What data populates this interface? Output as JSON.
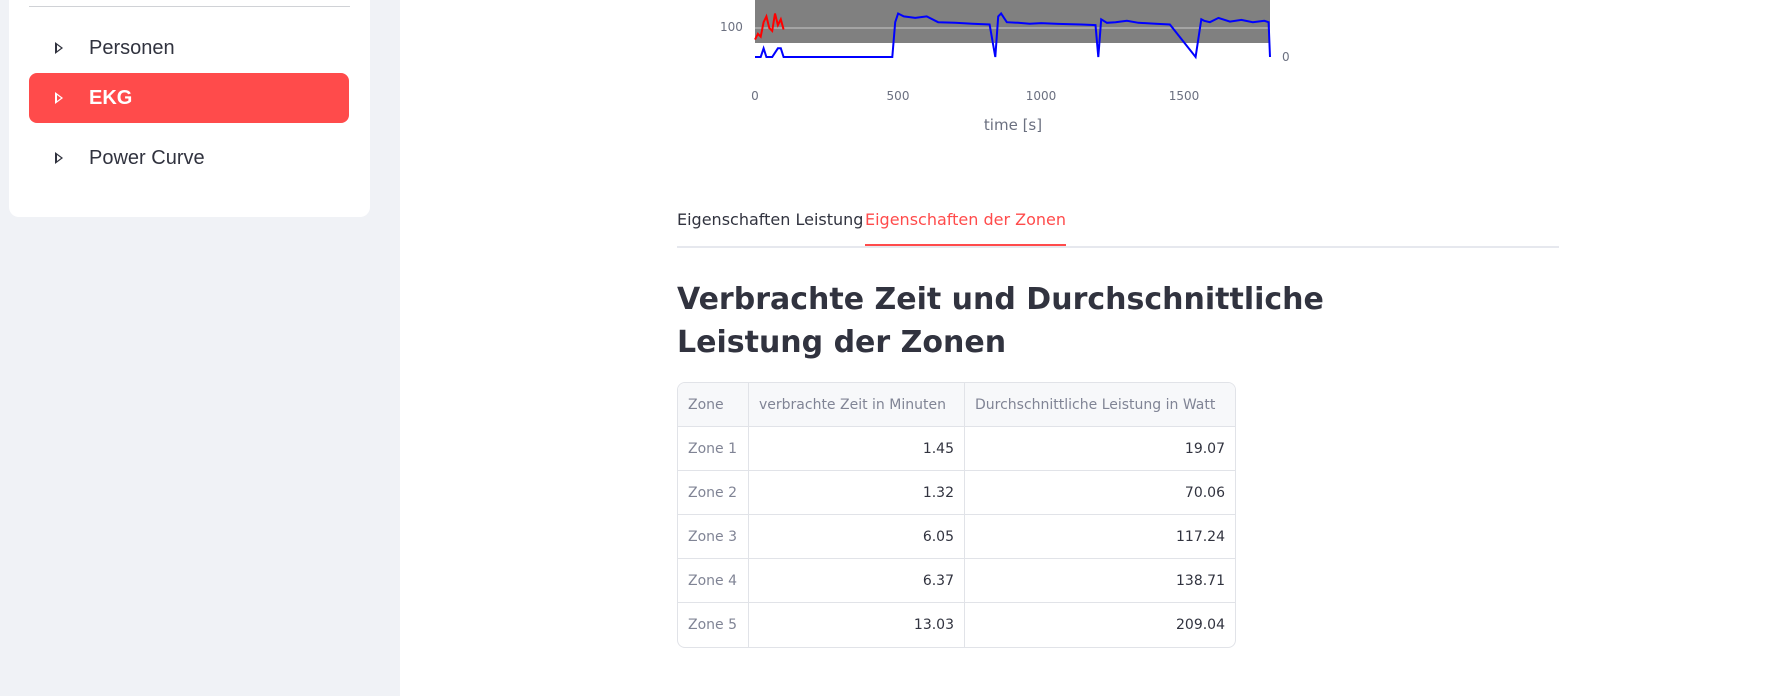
{
  "sidebar": {
    "items": [
      {
        "label": "Personen",
        "active": false
      },
      {
        "label": "EKG",
        "active": true
      },
      {
        "label": "Power Curve",
        "active": false
      }
    ]
  },
  "chart_data": {
    "type": "line",
    "xlabel": "time [s]",
    "x_ticks": [
      "0",
      "500",
      "1000",
      "1500"
    ],
    "y_ticks_left": [
      "100"
    ],
    "y_ticks_right": [
      "0"
    ],
    "xlim": [
      0,
      1800
    ],
    "series": [
      {
        "color": "#0000ff",
        "x": [
          0,
          20,
          30,
          40,
          60,
          80,
          90,
          100,
          480,
          490,
          500,
          520,
          560,
          600,
          640,
          700,
          760,
          820,
          840,
          850,
          860,
          880,
          920,
          960,
          1000,
          1060,
          1140,
          1190,
          1200,
          1210,
          1230,
          1260,
          1300,
          1340,
          1400,
          1450,
          1540,
          1560,
          1570,
          1590,
          1620,
          1660,
          1700,
          1740,
          1780,
          1795,
          1800
        ],
        "y": [
          0,
          0,
          30,
          0,
          0,
          30,
          30,
          0,
          0,
          120,
          150,
          140,
          135,
          140,
          120,
          118,
          115,
          112,
          0,
          140,
          150,
          120,
          118,
          115,
          117,
          114,
          112,
          110,
          0,
          130,
          118,
          120,
          125,
          118,
          115,
          112,
          0,
          130,
          125,
          120,
          135,
          122,
          128,
          120,
          125,
          120,
          0
        ]
      },
      {
        "color": "#ff0000",
        "x": [
          0,
          10,
          20,
          30,
          40,
          50,
          60,
          70,
          80,
          90,
          100
        ],
        "y": [
          60,
          80,
          70,
          120,
          140,
          100,
          90,
          150,
          110,
          130,
          95
        ]
      }
    ],
    "colors": {
      "plot_band": "#808080",
      "line_main": "#0000ff",
      "line_secondary": "#ff0000"
    }
  },
  "tabs": [
    {
      "label": "Eigenschaften Leistung",
      "active": false
    },
    {
      "label": "Eigenschaften der Zonen",
      "active": true
    }
  ],
  "section": {
    "title": "Verbrachte Zeit und Durchschnittliche Leistung der Zonen"
  },
  "table": {
    "headers": [
      "Zone",
      "verbrachte Zeit in Minuten",
      "Durchschnittliche Leistung in Watt"
    ],
    "rows": [
      [
        "Zone 1",
        "1.45",
        "19.07"
      ],
      [
        "Zone 2",
        "1.32",
        "70.06"
      ],
      [
        "Zone 3",
        "6.05",
        "117.24"
      ],
      [
        "Zone 4",
        "6.37",
        "138.71"
      ],
      [
        "Zone 5",
        "13.03",
        "209.04"
      ]
    ]
  },
  "colors": {
    "accent": "#ff4b4b",
    "sidebar_bg": "#f0f2f6",
    "text": "#31333f"
  }
}
